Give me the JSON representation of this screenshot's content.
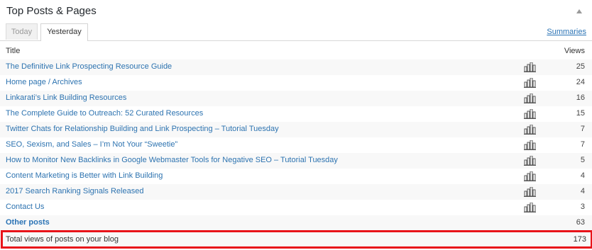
{
  "widget": {
    "title": "Top Posts & Pages",
    "collapse_icon": "triangle-up-icon",
    "tabs": [
      {
        "label": "Today",
        "active": false
      },
      {
        "label": "Yesterday",
        "active": true
      }
    ],
    "summaries_link": "Summaries"
  },
  "table": {
    "columns": {
      "title": "Title",
      "views": "Views"
    },
    "stats_icon": "bar-chart-icon",
    "rows": [
      {
        "title": "The Definitive Link Prospecting Resource Guide",
        "views": "25"
      },
      {
        "title": "Home page / Archives",
        "views": "24"
      },
      {
        "title": "Linkarati’s Link Building Resources",
        "views": "16"
      },
      {
        "title": "The Complete Guide to Outreach: 52 Curated Resources",
        "views": "15"
      },
      {
        "title": "Twitter Chats for Relationship Building and Link Prospecting – Tutorial Tuesday",
        "views": "7"
      },
      {
        "title": "SEO, Sexism, and Sales – I’m Not Your “Sweetie”",
        "views": "7"
      },
      {
        "title": "How to Monitor New Backlinks in Google Webmaster Tools for Negative SEO – Tutorial Tuesday",
        "views": "5"
      },
      {
        "title": "Content Marketing is Better with Link Building",
        "views": "4"
      },
      {
        "title": "2017 Search Ranking Signals Released",
        "views": "4"
      },
      {
        "title": "Contact Us",
        "views": "3"
      }
    ],
    "other_posts": {
      "title": "Other posts",
      "views": "63"
    },
    "total": {
      "title": "Total views of posts on your blog",
      "views": "173"
    }
  },
  "colors": {
    "link": "#2d73b0",
    "highlight_border": "#e8141a",
    "row_stripe": "#f8f8f8"
  }
}
